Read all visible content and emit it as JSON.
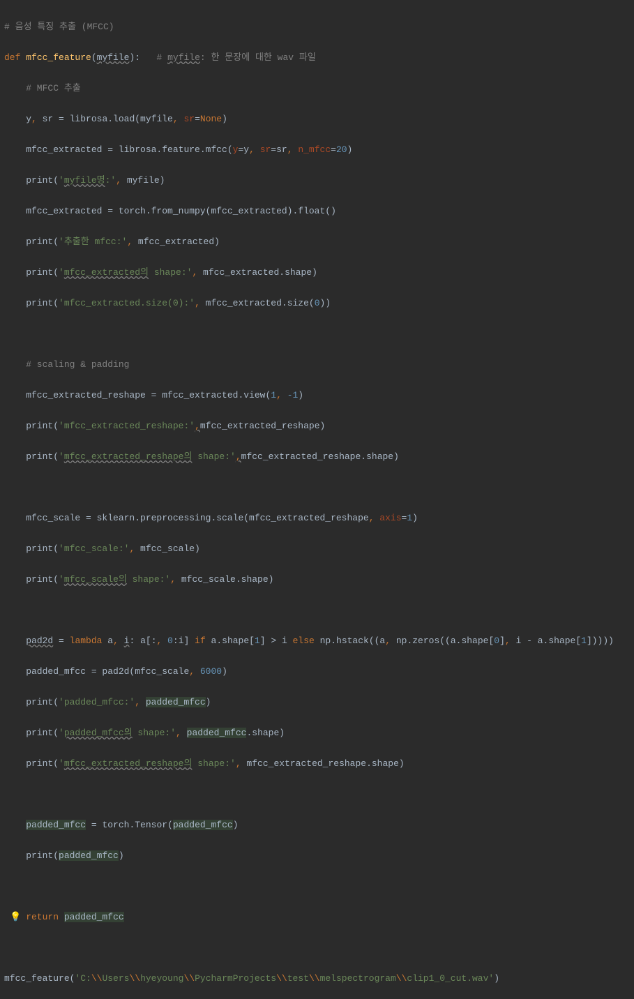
{
  "lines": {
    "l01_cm": "# 음성 특징 추출 (MFCC)",
    "l02_def": "def ",
    "l02_fn": "mfcc_feature",
    "l02_p1": "(",
    "l02_param": "myfile",
    "l02_p2": "):   ",
    "l02_cm2": "# ",
    "l02_cm_param": "myfile",
    "l02_cm3": ": 한 문장에 대한 wav 파일",
    "l03_cm": "    # MFCC 추출",
    "l04_a": "    y",
    "l04_b": ", ",
    "l04_c": "sr = librosa.load(myfile",
    "l04_d": ", ",
    "l04_kw": "sr",
    "l04_eq": "=",
    "l04_none": "None",
    "l04_end": ")",
    "l05_a": "    mfcc_extracted = librosa.feature.mfcc(",
    "l05_kw1": "y",
    "l05_b": "=y",
    "l05_c": ", ",
    "l05_kw2": "sr",
    "l05_d": "=sr",
    "l05_e": ", ",
    "l05_kw3": "n_mfcc",
    "l05_f": "=",
    "l05_num": "20",
    "l05_end": ")",
    "l06_a": "    print(",
    "l06_st": "'",
    "l06_stw": "myfile명",
    "l06_st2": ":'",
    "l06_b": ", ",
    "l06_c": "myfile)",
    "l07_a": "    mfcc_extracted = torch.from_numpy(mfcc_extracted).float()",
    "l08_a": "    print(",
    "l08_st": "'추출한 mfcc:'",
    "l08_b": ", ",
    "l08_c": "mfcc_extracted)",
    "l09_a": "    print(",
    "l09_st1": "'",
    "l09_stw": "mfcc_extracted의",
    "l09_st2": " shape:'",
    "l09_b": ", ",
    "l09_c": "mfcc_extracted.shape)",
    "l10_a": "    print(",
    "l10_st": "'mfcc_extracted.size(0):'",
    "l10_b": ", ",
    "l10_c": "mfcc_extracted.size(",
    "l10_num": "0",
    "l10_end": "))",
    "l12_cm": "    # scaling & padding",
    "l13_a": "    mfcc_extracted_reshape = mfcc_extracted.view(",
    "l13_n1": "1",
    "l13_b": ", ",
    "l13_n2": "-1",
    "l13_end": ")",
    "l14_a": "    print(",
    "l14_st": "'mfcc_extracted_reshape:'",
    "l14_w": ",",
    "l14_c": "mfcc_extracted_reshape)",
    "l15_a": "    print(",
    "l15_st1": "'",
    "l15_stw": "mfcc_extracted_reshape의",
    "l15_st2": " shape:'",
    "l15_w": ",",
    "l15_c": "mfcc_extracted_reshape.shape)",
    "l17_a": "    mfcc_scale = sklearn.preprocessing.scale(mfcc_extracted_reshape",
    "l17_b": ", ",
    "l17_kw": "axis",
    "l17_eq": "=",
    "l17_num": "1",
    "l17_end": ")",
    "l18_a": "    print(",
    "l18_st": "'mfcc_scale:'",
    "l18_b": ", ",
    "l18_c": "mfcc_scale)",
    "l19_a": "    print(",
    "l19_st1": "'",
    "l19_stw": "mfcc_scale의",
    "l19_st2": " shape:'",
    "l19_b": ", ",
    "l19_c": "mfcc_scale.shape)",
    "l21_a": "    ",
    "l21_w": "pad2d",
    "l21_b": " = ",
    "l21_lam": "lambda ",
    "l21_c": "a",
    "l21_d": ", ",
    "l21_w2": "i",
    "l21_e": ": a[:",
    "l21_f": ", ",
    "l21_n0": "0",
    "l21_g": ":i] ",
    "l21_if": "if ",
    "l21_h": "a.shape[",
    "l21_n1": "1",
    "l21_i": "] > i ",
    "l21_else": "else ",
    "l21_j": "np.hstack((a",
    "l21_k": ", ",
    "l21_l": "np.zeros((a.shape[",
    "l21_n0b": "0",
    "l21_m": "]",
    "l21_n": ", ",
    "l21_o": "i - a.shape[",
    "l21_n1b": "1",
    "l21_p": "]))))",
    "l22_a": "    padded_mfcc = pad2d(mfcc_scale",
    "l22_b": ", ",
    "l22_num": "6000",
    "l22_end": ")",
    "l23_a": "    print(",
    "l23_st": "'padded_mfcc:'",
    "l23_b": ", ",
    "l23_hl": "padded_mfcc",
    "l23_end": ")",
    "l24_a": "    print(",
    "l24_st1": "'",
    "l24_stw": "padded_mfcc의",
    "l24_st2": " shape:'",
    "l24_b": ", ",
    "l24_hl": "padded_mfcc",
    "l24_end": ".shape)",
    "l25_a": "    print(",
    "l25_st1": "'",
    "l25_stw": "mfcc_extracted_reshape의",
    "l25_st2": " shape:'",
    "l25_b": ", ",
    "l25_c": "mfcc_extracted_reshape.shape)",
    "l27_a": "    ",
    "l27_hl1": "padded_mfcc",
    "l27_b": " = torch.Tensor(",
    "l27_hl2": "padded_mfcc",
    "l27_end": ")",
    "l28_a": "    print(",
    "l28_hl": "padded_mfcc",
    "l28_end": ")",
    "l30_ret": "    return ",
    "l30_hl": "padded_mfcc",
    "l32_a": "mfcc_feature(",
    "l32_q": "'C:",
    "l32_e1": "\\\\",
    "l32_p1": "Users",
    "l32_e2": "\\\\",
    "l32_p2": "hyeyoung",
    "l32_e3": "\\\\",
    "l32_p3": "PycharmProjects",
    "l32_e4": "\\\\",
    "l32_p4": "test",
    "l32_e5": "\\\\",
    "l32_p5": "melspectrogram",
    "l32_e6": "\\\\",
    "l32_p6": "clip1_0_cut.wav'",
    "l32_end": ")"
  }
}
